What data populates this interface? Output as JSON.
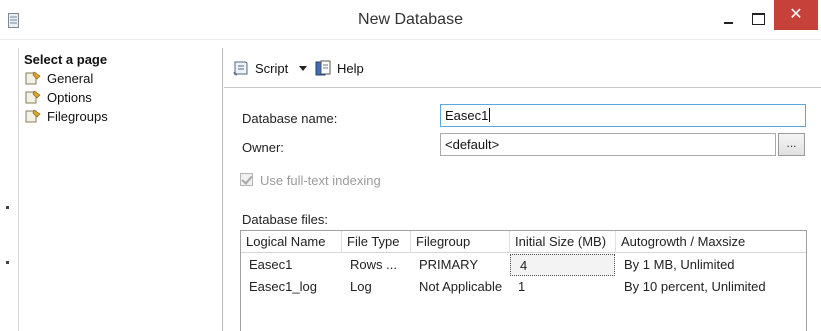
{
  "window": {
    "title": "New Database",
    "close_glyph": "✕"
  },
  "left_pane": {
    "header": "Select a page",
    "items": [
      {
        "label": "General",
        "icon": "page-wrench-icon"
      },
      {
        "label": "Options",
        "icon": "page-wrench-icon"
      },
      {
        "label": "Filegroups",
        "icon": "page-wrench-icon"
      }
    ]
  },
  "toolbar": {
    "script_label": "Script",
    "help_label": "Help"
  },
  "form": {
    "database_name_label": "Database name:",
    "database_name_value": "Easec1",
    "owner_label": "Owner:",
    "owner_value": "<default>",
    "browse_label": "...",
    "fulltext_label": "Use full-text indexing",
    "fulltext_checked": true,
    "database_files_label": "Database files:"
  },
  "files_table": {
    "columns": [
      "Logical Name",
      "File Type",
      "Filegroup",
      "Initial Size (MB)",
      "Autogrowth / Maxsize"
    ],
    "rows": [
      [
        "Easec1",
        "Rows ...",
        "PRIMARY",
        "4",
        "By 1 MB, Unlimited"
      ],
      [
        "Easec1_log",
        "Log",
        "Not Applicable",
        "1",
        "By 10 percent, Unlimited"
      ]
    ]
  },
  "colors": {
    "close_button": "#c7413b",
    "focus_border": "#5ea6df"
  }
}
